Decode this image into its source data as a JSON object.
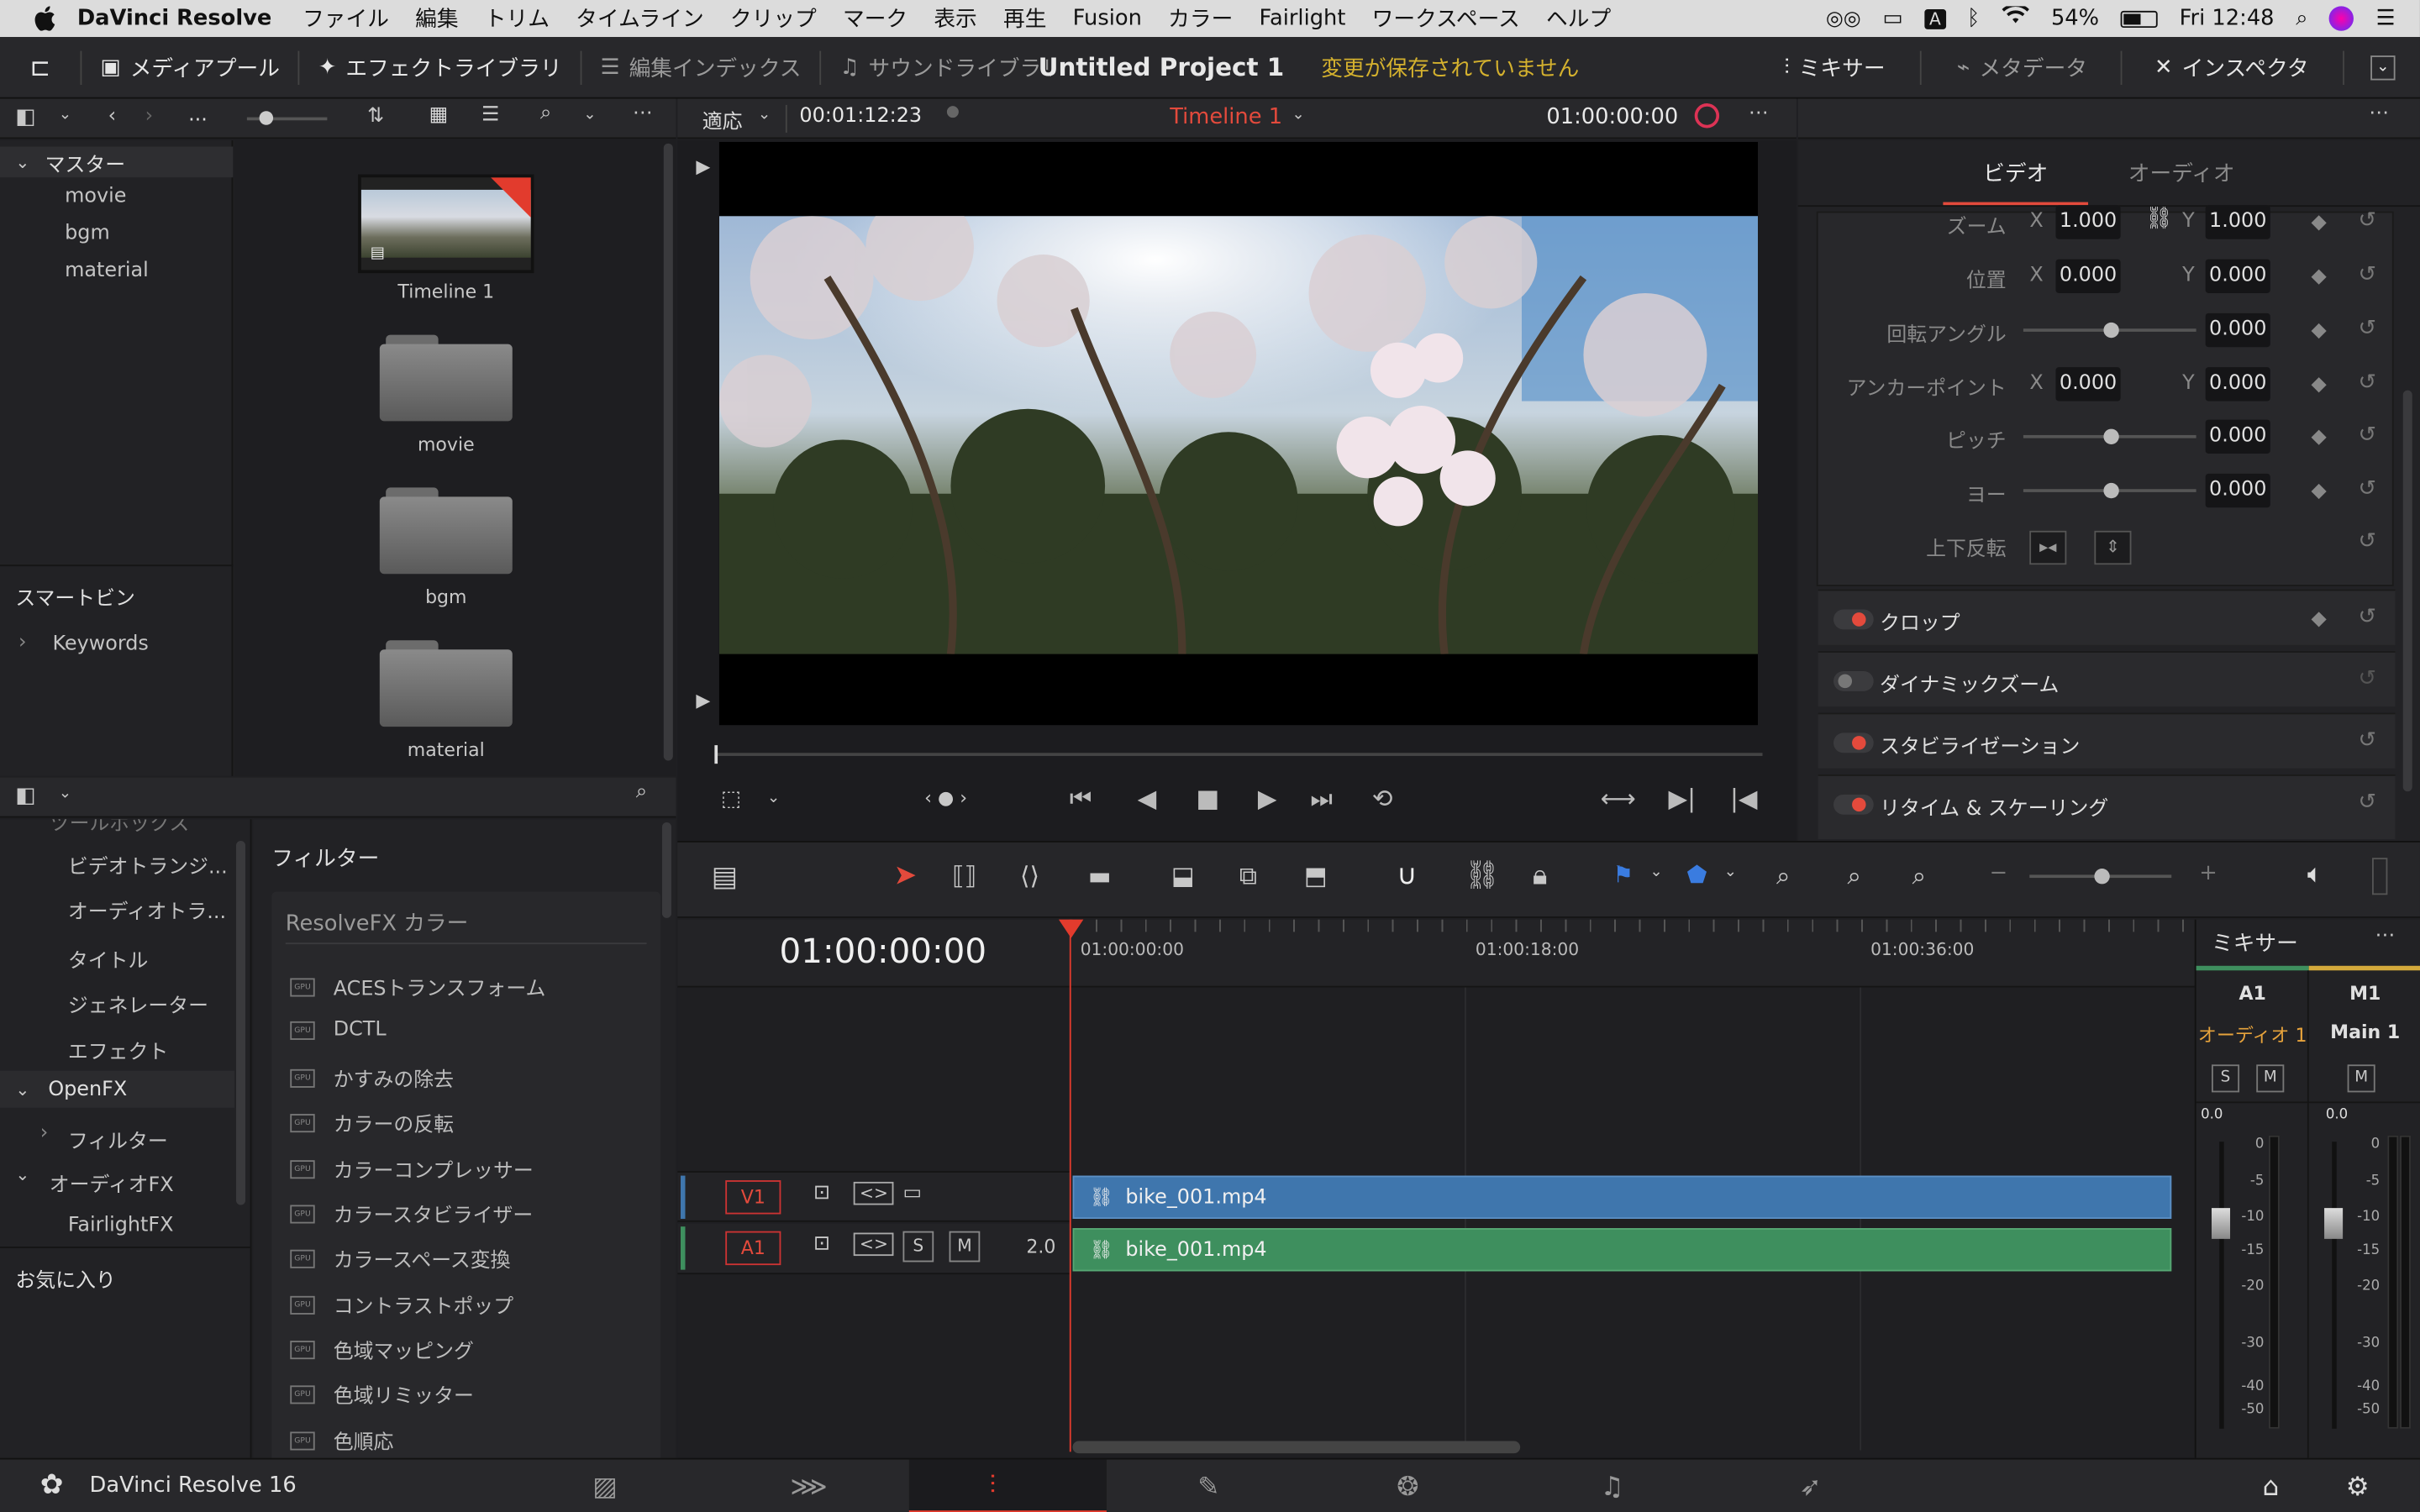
{
  "menubar": {
    "app": "DaVinci Resolve",
    "items": [
      "ファイル",
      "編集",
      "トリム",
      "タイムライン",
      "クリップ",
      "マーク",
      "表示",
      "再生",
      "Fusion",
      "カラー",
      "Fairlight",
      "ワークスペース",
      "ヘルプ"
    ],
    "battery": "54%",
    "clock": "Fri 12:48",
    "input_mode": "A"
  },
  "toolbar": {
    "media_pool": "メディアプール",
    "effects_library": "エフェクトライブラリ",
    "edit_index": "編集インデックス",
    "sound_library": "サウンドライブラリ",
    "project_title": "Untitled Project 1",
    "unsaved": "変更が保存されていません",
    "mixer": "ミキサー",
    "metadata": "メタデータ",
    "inspector": "インスペクタ"
  },
  "media_pool": {
    "path_label": "...",
    "tree_header": "マスター",
    "tree_items": [
      "movie",
      "bgm",
      "material"
    ],
    "smart_bins": "スマートビン",
    "keywords": "Keywords",
    "clips": [
      {
        "name": "Timeline 1",
        "type": "timeline"
      },
      {
        "name": "movie",
        "type": "folder"
      },
      {
        "name": "bgm",
        "type": "folder"
      },
      {
        "name": "material",
        "type": "folder"
      }
    ]
  },
  "effects": {
    "toolbox_cut": "ツールボックス",
    "categories": [
      "ビデオトランジ...",
      "オーディオトラ...",
      "タイトル",
      "ジェネレーター",
      "エフェクト"
    ],
    "openfx": "OpenFX",
    "openfx_filter": "フィルター",
    "audiofx": "オーディオFX",
    "fairlightfx": "FairlightFX",
    "favorites": "お気に入り",
    "list_title": "フィルター",
    "group_title": "ResolveFX カラー",
    "gpu_badge": "GPU",
    "items": [
      "ACESトランスフォーム",
      "DCTL",
      "かすみの除去",
      "カラーの反転",
      "カラーコンプレッサー",
      "カラースタビライザー",
      "カラースペース変換",
      "コントラストポップ",
      "色域マッピング",
      "色域リミッター",
      "色順応"
    ]
  },
  "viewer": {
    "fit": "適応",
    "duration": "00:01:12:23",
    "timeline_name": "Timeline 1",
    "timecode": "01:00:00:00",
    "scrub_progress": 0.0
  },
  "inspector": {
    "tabs": [
      "ビデオ",
      "オーディオ"
    ],
    "active_tab": "ビデオ",
    "zoom": {
      "label": "ズーム",
      "x": "1.000",
      "y": "1.000"
    },
    "position": {
      "label": "位置",
      "x": "0.000",
      "y": "0.000"
    },
    "rotation": {
      "label": "回転アングル",
      "value": "0.000"
    },
    "anchor": {
      "label": "アンカーポイント",
      "x": "0.000",
      "y": "0.000"
    },
    "pitch": {
      "label": "ピッチ",
      "value": "0.000"
    },
    "yaw": {
      "label": "ヨー",
      "value": "0.000"
    },
    "flip": {
      "label": "上下反転"
    },
    "axis_x": "X",
    "axis_y": "Y",
    "sections": [
      {
        "label": "クロップ",
        "enabled": true
      },
      {
        "label": "ダイナミックズーム",
        "enabled": false
      },
      {
        "label": "スタビライゼーション",
        "enabled": true
      },
      {
        "label": "リタイム & スケーリング",
        "enabled": true
      }
    ]
  },
  "timeline": {
    "timecode": "01:00:00:00",
    "ruler": [
      "01:00:00:00",
      "01:00:18:00",
      "01:00:36:00"
    ],
    "tracks": [
      {
        "id": "V1",
        "clip": "bike_001.mp4",
        "color": "#3f76ad"
      },
      {
        "id": "A1",
        "clip": "bike_001.mp4",
        "color": "#3e8f5e",
        "level": "2.0",
        "solo": "S",
        "mute": "M"
      }
    ]
  },
  "mixer": {
    "title": "ミキサー",
    "channels": [
      {
        "id": "A1",
        "name": "オーディオ 1",
        "buttons": [
          "S",
          "M"
        ],
        "gain": "0.0"
      },
      {
        "id": "M1",
        "name": "Main 1",
        "buttons": [
          "M"
        ],
        "gain": "0.0"
      }
    ],
    "scale": [
      "0",
      "-5",
      "-10",
      "-15",
      "-20",
      "-30",
      "-40",
      "-50"
    ]
  },
  "bottombar": {
    "app_name": "DaVinci Resolve 16",
    "active_page": "edit"
  }
}
